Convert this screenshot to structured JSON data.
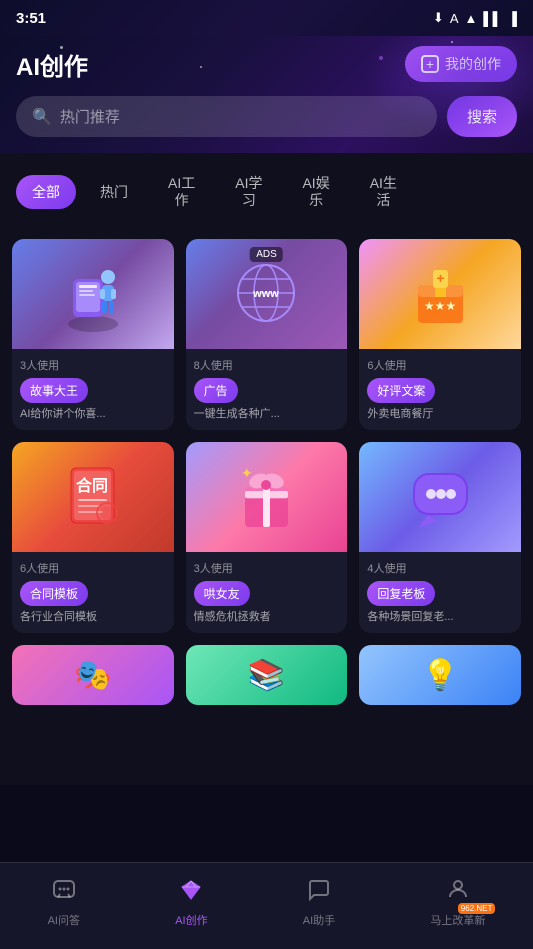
{
  "statusBar": {
    "time": "3:51",
    "icons": [
      "download",
      "sim",
      "wifi",
      "battery"
    ]
  },
  "header": {
    "title": "AI创作",
    "myCreationBtn": "我的创作"
  },
  "search": {
    "placeholder": "热门推荐",
    "btnLabel": "搜索"
  },
  "categories": [
    {
      "id": "all",
      "label": "全部",
      "active": true
    },
    {
      "id": "hot",
      "label": "热门",
      "active": false
    },
    {
      "id": "work",
      "label": "AI工\n作",
      "active": false
    },
    {
      "id": "study",
      "label": "AI学\n习",
      "active": false
    },
    {
      "id": "entertainment",
      "label": "AI娱\n乐",
      "active": false
    },
    {
      "id": "life",
      "label": "AI生\n活",
      "active": false
    }
  ],
  "cards": [
    {
      "id": "card1",
      "usage": "3人使用",
      "tag": "故事大王",
      "desc": "AI给你讲个你喜...",
      "imageType": "blue-figure",
      "hasAds": false
    },
    {
      "id": "card2",
      "usage": "8人使用",
      "tag": "广告",
      "desc": "一键生成各种广...",
      "imageType": "www-ads",
      "hasAds": true
    },
    {
      "id": "card3",
      "usage": "6人使用",
      "tag": "好评文案",
      "desc": "外卖电商餐厅",
      "imageType": "orange-box",
      "hasAds": false
    },
    {
      "id": "card4",
      "usage": "6人使用",
      "tag": "合同模板",
      "desc": "各行业合同模板",
      "imageType": "contract",
      "hasAds": false
    },
    {
      "id": "card5",
      "usage": "3人使用",
      "tag": "哄女友",
      "desc": "情感危机拯救者",
      "imageType": "gift-pink",
      "hasAds": false
    },
    {
      "id": "card6",
      "usage": "4人使用",
      "tag": "回复老板",
      "desc": "各种场景回复老...",
      "imageType": "chat-bubble",
      "hasAds": false
    }
  ],
  "partialCards": [
    {
      "id": "pc1",
      "imageType": "partial-1"
    },
    {
      "id": "pc2",
      "imageType": "partial-2"
    },
    {
      "id": "pc3",
      "imageType": "partial-3"
    }
  ],
  "bottomNav": [
    {
      "id": "qa",
      "label": "AI问答",
      "icon": "chat",
      "active": false
    },
    {
      "id": "create",
      "label": "AI创作",
      "icon": "diamond",
      "active": true
    },
    {
      "id": "assistant",
      "label": "AI助手",
      "icon": "message",
      "active": false
    },
    {
      "id": "profile",
      "label": "马上改革新",
      "icon": "person",
      "active": false
    }
  ],
  "watermark": "962.NET\n马上改革新"
}
